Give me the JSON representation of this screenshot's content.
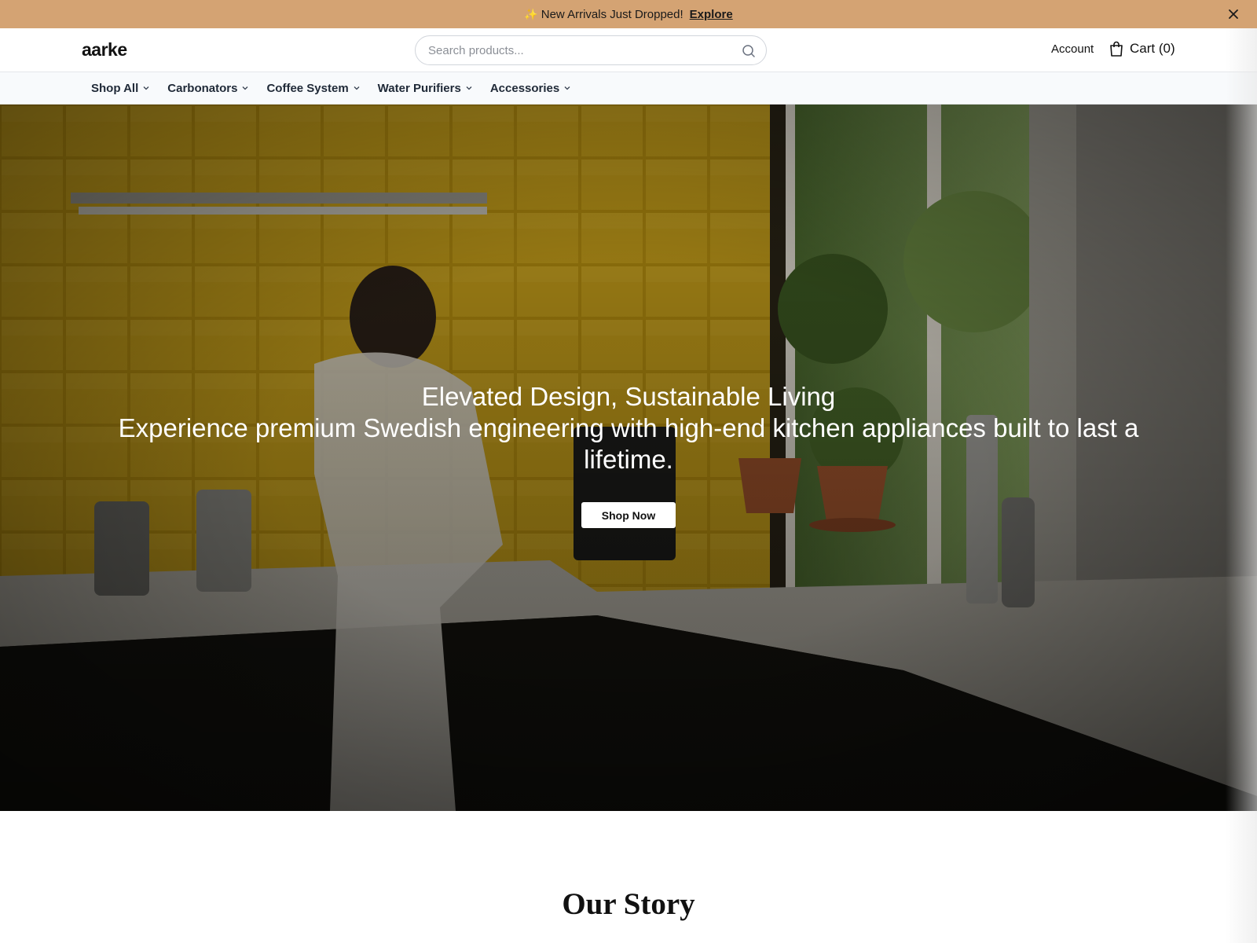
{
  "announcement": {
    "sparkle": "✨",
    "text": "New Arrivals Just Dropped!",
    "link": "Explore"
  },
  "header": {
    "logo": "aarke",
    "search_placeholder": "Search products...",
    "account": "Account",
    "cart": "Cart (0)"
  },
  "nav": {
    "items": [
      {
        "label": "Shop All"
      },
      {
        "label": "Carbonators"
      },
      {
        "label": "Coffee System"
      },
      {
        "label": "Water Purifiers"
      },
      {
        "label": "Accessories"
      }
    ]
  },
  "hero": {
    "title": "Elevated Design, Sustainable Living",
    "subtitle": "Experience premium Swedish engineering with high-end kitchen appliances built to last a lifetime.",
    "cta": "Shop Now"
  },
  "story": {
    "title": "Our Story"
  },
  "colors": {
    "announcement_bg": "#d4a373",
    "tile_yellow": "#c9a11a",
    "nav_bg": "#f8fafc"
  }
}
